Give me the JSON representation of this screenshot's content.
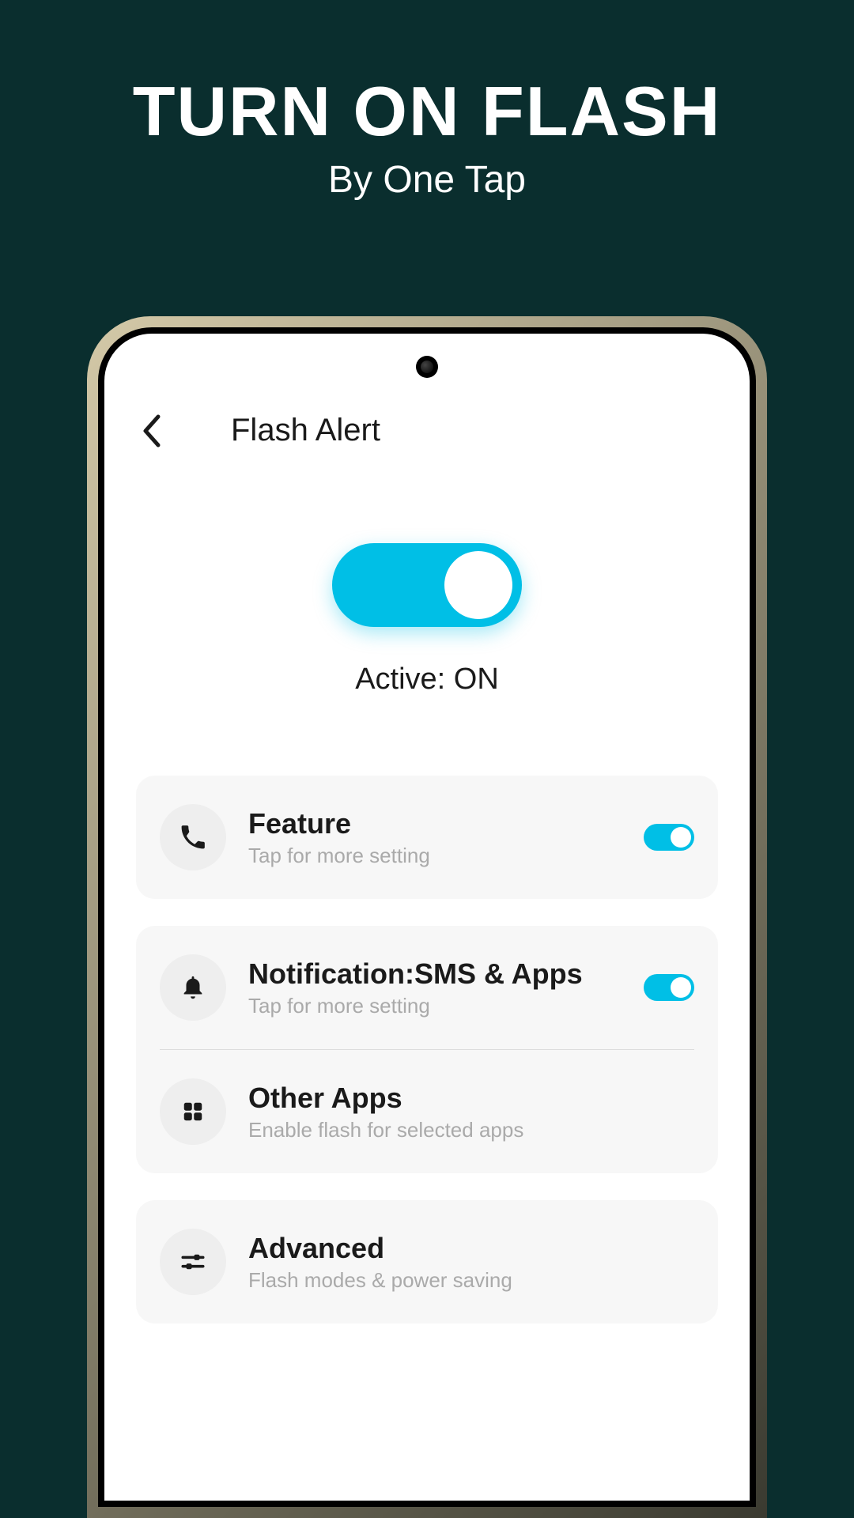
{
  "hero": {
    "title": "TURN ON FLASH",
    "subtitle": "By One Tap"
  },
  "header": {
    "title": "Flash Alert"
  },
  "mainToggle": {
    "label": "Active: ON",
    "on": true
  },
  "cards": [
    {
      "items": [
        {
          "icon": "phone-icon",
          "title": "Feature",
          "subtitle": "Tap for more setting",
          "hasToggle": true
        }
      ]
    },
    {
      "items": [
        {
          "icon": "bell-icon",
          "title": "Notification:SMS & Apps",
          "subtitle": "Tap for more setting",
          "hasToggle": true
        },
        {
          "icon": "grid-icon",
          "title": "Other Apps",
          "subtitle": "Enable flash for selected apps",
          "hasToggle": false
        }
      ]
    },
    {
      "items": [
        {
          "icon": "sliders-icon",
          "title": "Advanced",
          "subtitle": "Flash modes & power saving",
          "hasToggle": false
        }
      ]
    }
  ]
}
